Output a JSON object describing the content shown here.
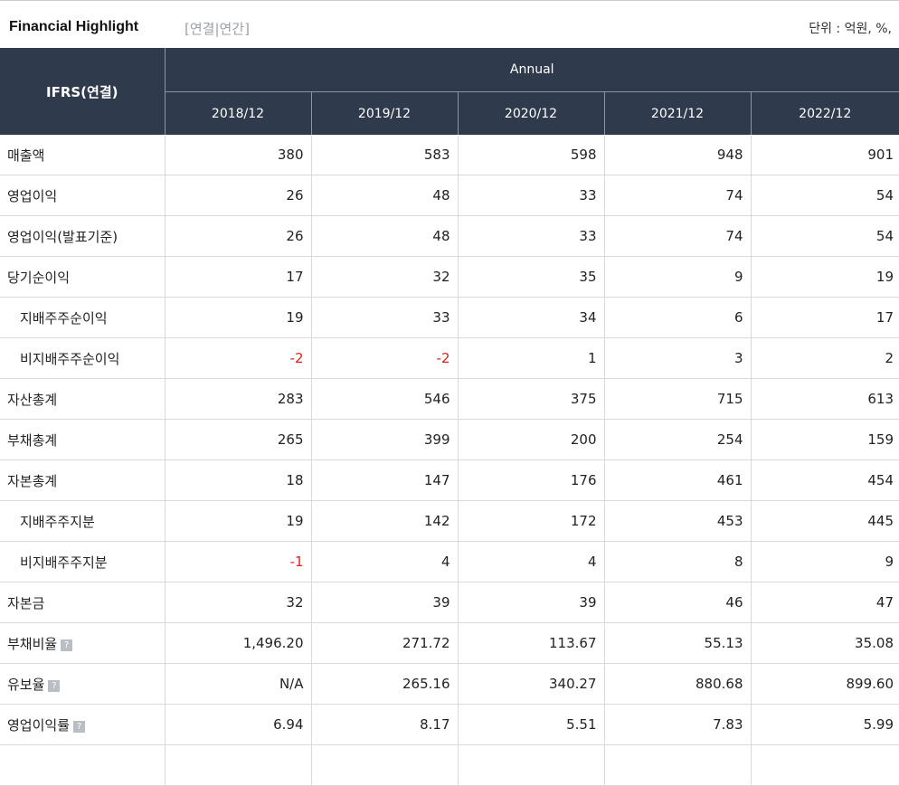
{
  "header": {
    "title": "Financial Highlight",
    "subtitle": "[연결|연간]",
    "unit": "단위 : 억원, %,"
  },
  "table": {
    "corner": "IFRS(연결)",
    "group": "Annual",
    "years": [
      "2018/12",
      "2019/12",
      "2020/12",
      "2021/12",
      "2022/12"
    ],
    "rows": [
      {
        "label": "매출액",
        "values": [
          "380",
          "583",
          "598",
          "948",
          "901"
        ]
      },
      {
        "label": "영업이익",
        "values": [
          "26",
          "48",
          "33",
          "74",
          "54"
        ]
      },
      {
        "label": "영업이익(발표기준)",
        "values": [
          "26",
          "48",
          "33",
          "74",
          "54"
        ]
      },
      {
        "label": "당기순이익",
        "values": [
          "17",
          "32",
          "35",
          "9",
          "19"
        ]
      },
      {
        "label": "지배주주순이익",
        "values": [
          "19",
          "33",
          "34",
          "6",
          "17"
        ]
      },
      {
        "label": "비지배주주순이익",
        "values": [
          "-2",
          "-2",
          "1",
          "3",
          "2"
        ]
      },
      {
        "label": "자산총계",
        "values": [
          "283",
          "546",
          "375",
          "715",
          "613"
        ]
      },
      {
        "label": "부채총계",
        "values": [
          "265",
          "399",
          "200",
          "254",
          "159"
        ]
      },
      {
        "label": "자본총계",
        "values": [
          "18",
          "147",
          "176",
          "461",
          "454"
        ]
      },
      {
        "label": "지배주주지분",
        "values": [
          "19",
          "142",
          "172",
          "453",
          "445"
        ]
      },
      {
        "label": "비지배주주지분",
        "values": [
          "-1",
          "4",
          "4",
          "8",
          "9"
        ]
      },
      {
        "label": "자본금",
        "values": [
          "32",
          "39",
          "39",
          "46",
          "47"
        ]
      },
      {
        "label": "부채비율",
        "values": [
          "1,496.20",
          "271.72",
          "113.67",
          "55.13",
          "35.08"
        ]
      },
      {
        "label": "유보율",
        "values": [
          "N/A",
          "265.16",
          "340.27",
          "880.68",
          "899.60"
        ]
      },
      {
        "label": "영업이익률",
        "values": [
          "6.94",
          "8.17",
          "5.51",
          "7.83",
          "5.99"
        ]
      }
    ],
    "help_icon": "question-icon",
    "negative_color": "#e02020"
  }
}
